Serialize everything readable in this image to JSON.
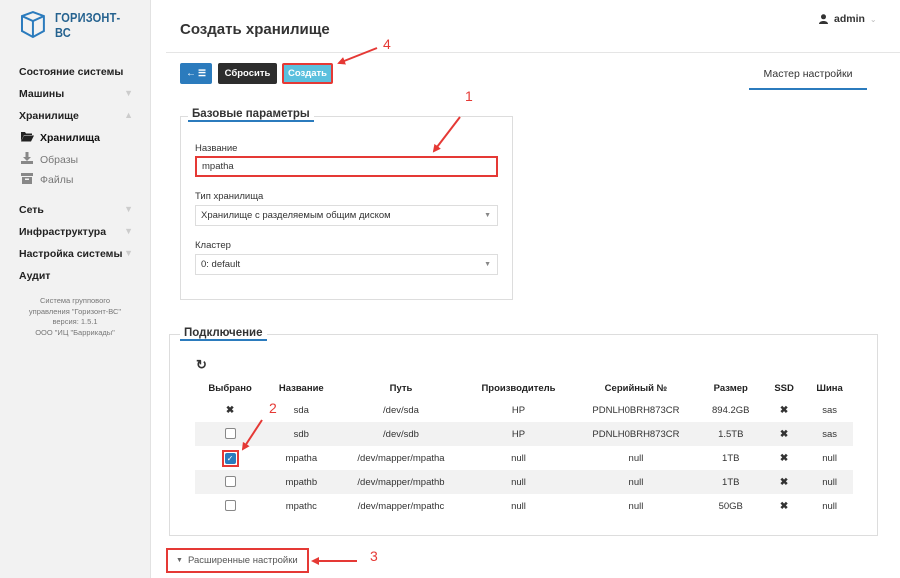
{
  "app": {
    "logo_text": "ГОРИЗОНТ-ВС"
  },
  "sidebar": {
    "items": [
      {
        "label": "Состояние системы",
        "chevron": false
      },
      {
        "label": "Машины",
        "chevron": true
      },
      {
        "label": "Хранилище",
        "chevron": true
      },
      {
        "label": "Сеть",
        "chevron": true
      },
      {
        "label": "Инфраструктура",
        "chevron": true
      },
      {
        "label": "Настройка системы",
        "chevron": true
      },
      {
        "label": "Аудит",
        "chevron": false
      }
    ],
    "storage_sub": [
      {
        "label": "Хранилища",
        "icon": "folder-open-icon",
        "active": true
      },
      {
        "label": "Образы",
        "icon": "download-icon",
        "active": false
      },
      {
        "label": "Файлы",
        "icon": "archive-icon",
        "active": false
      }
    ],
    "info": [
      "Система группового",
      "управления \"Горизонт-ВС\"",
      "версия: 1.5.1",
      "ООО \"ИЦ \"Баррикады\""
    ]
  },
  "header": {
    "title": "Создать хранилище",
    "user": "admin"
  },
  "toolbar": {
    "reset_label": "Сбросить",
    "create_label": "Создать",
    "wizard_tab": "Мастер настройки"
  },
  "basic": {
    "legend": "Базовые параметры",
    "name_label": "Название",
    "name_value": "mpatha",
    "type_label": "Тип хранилища",
    "type_value": "Хранилище с разделяемым общим диском",
    "cluster_label": "Кластер",
    "cluster_value": "0: default"
  },
  "connection": {
    "legend": "Подключение",
    "columns": [
      "Выбрано",
      "Название",
      "Путь",
      "Производитель",
      "Серийный №",
      "Размер",
      "SSD",
      "Шина"
    ],
    "rows": [
      {
        "selected": "x",
        "name": "sda",
        "path": "/dev/sda",
        "vendor": "HP",
        "serial": "PDNLH0BRH873CR",
        "size": "894.2GB",
        "ssd": "x",
        "bus": "sas"
      },
      {
        "selected": "unchecked",
        "name": "sdb",
        "path": "/dev/sdb",
        "vendor": "HP",
        "serial": "PDNLH0BRH873CR",
        "size": "1.5TB",
        "ssd": "x",
        "bus": "sas"
      },
      {
        "selected": "checked",
        "name": "mpatha",
        "path": "/dev/mapper/mpatha",
        "vendor": "null",
        "serial": "null",
        "size": "1TB",
        "ssd": "x",
        "bus": "null"
      },
      {
        "selected": "unchecked",
        "name": "mpathb",
        "path": "/dev/mapper/mpathb",
        "vendor": "null",
        "serial": "null",
        "size": "1TB",
        "ssd": "x",
        "bus": "null"
      },
      {
        "selected": "unchecked",
        "name": "mpathc",
        "path": "/dev/mapper/mpathc",
        "vendor": "null",
        "serial": "null",
        "size": "50GB",
        "ssd": "x",
        "bus": "null"
      }
    ]
  },
  "advanced": {
    "label": "Расширенные настройки"
  },
  "annotations": [
    "1",
    "2",
    "3",
    "4"
  ],
  "colors": {
    "accent": "#2b7bbd",
    "create": "#5bc0de",
    "annotation": "#e53935"
  }
}
